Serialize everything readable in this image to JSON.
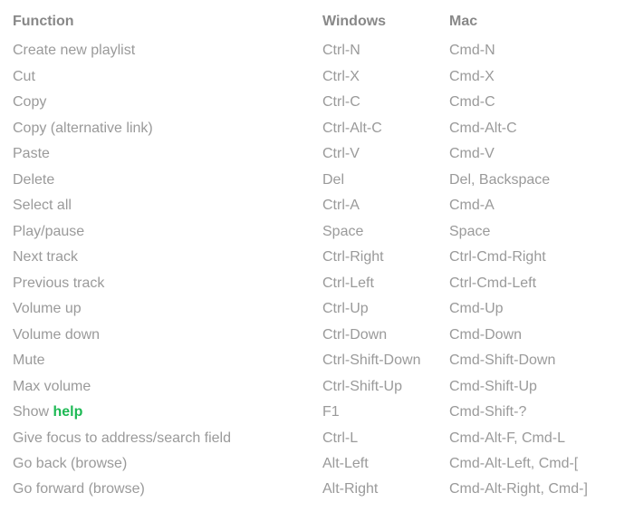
{
  "headers": {
    "function": "Function",
    "windows": "Windows",
    "mac": "Mac"
  },
  "rows": [
    {
      "function": "Create new playlist",
      "windows": "Ctrl-N",
      "mac": "Cmd-N"
    },
    {
      "function": "Cut",
      "windows": "Ctrl-X",
      "mac": "Cmd-X"
    },
    {
      "function": "Copy",
      "windows": "Ctrl-C",
      "mac": "Cmd-C"
    },
    {
      "function": "Copy (alternative link)",
      "windows": "Ctrl-Alt-C",
      "mac": "Cmd-Alt-C"
    },
    {
      "function": "Paste",
      "windows": "Ctrl-V",
      "mac": "Cmd-V"
    },
    {
      "function": "Delete",
      "windows": "Del",
      "mac": "Del, Backspace"
    },
    {
      "function": "Select all",
      "windows": "Ctrl-A",
      "mac": "Cmd-A"
    },
    {
      "function": "Play/pause",
      "windows": "Space",
      "mac": "Space"
    },
    {
      "function": "Next track",
      "windows": "Ctrl-Right",
      "mac": "Ctrl-Cmd-Right"
    },
    {
      "function": "Previous track",
      "windows": "Ctrl-Left",
      "mac": "Ctrl-Cmd-Left"
    },
    {
      "function": "Volume up",
      "windows": "Ctrl-Up",
      "mac": "Cmd-Up"
    },
    {
      "function": "Volume down",
      "windows": "Ctrl-Down",
      "mac": "Cmd-Down"
    },
    {
      "function": "Mute",
      "windows": "Ctrl-Shift-Down",
      "mac": "Cmd-Shift-Down"
    },
    {
      "function": "Max volume",
      "windows": "Ctrl-Shift-Up",
      "mac": "Cmd-Shift-Up"
    },
    {
      "function_prefix": "Show ",
      "function_link": "help",
      "windows": "F1",
      "mac": "Cmd-Shift-?"
    },
    {
      "function": "Give focus to address/search field",
      "windows": "Ctrl-L",
      "mac": "Cmd-Alt-F, Cmd-L"
    },
    {
      "function": "Go back (browse)",
      "windows": "Alt-Left",
      "mac": "Cmd-Alt-Left, Cmd-["
    },
    {
      "function": "Go forward (browse)",
      "windows": "Alt-Right",
      "mac": "Cmd-Alt-Right, Cmd-]"
    }
  ]
}
